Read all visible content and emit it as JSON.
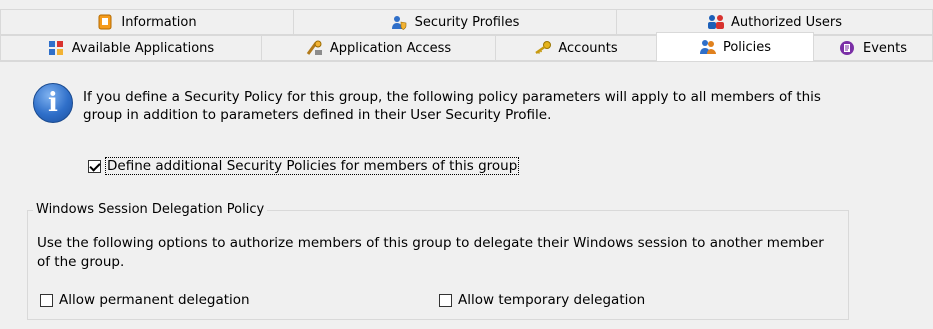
{
  "tabs_row1": [
    {
      "label": "Information",
      "icon": "notebook-icon"
    },
    {
      "label": "Security Profiles",
      "icon": "user-shield-icon"
    },
    {
      "label": "Authorized Users",
      "icon": "users-icon"
    }
  ],
  "tabs_row2": [
    {
      "label": "Available Applications",
      "icon": "apps-grid-icon"
    },
    {
      "label": "Application Access",
      "icon": "app-access-icon"
    },
    {
      "label": "Accounts",
      "icon": "keys-icon"
    },
    {
      "label": "Policies",
      "icon": "policy-users-icon",
      "active": true
    },
    {
      "label": "Events",
      "icon": "events-icon"
    }
  ],
  "info": {
    "text": "If you define a Security Policy for this group, the following policy parameters will apply to all members of this group in addition to parameters defined in their User Security Profile."
  },
  "define_policies": {
    "label": "Define additional Security Policies for members of this group",
    "checked": true
  },
  "delegation": {
    "legend": "Windows Session Delegation Policy",
    "description": "Use the following options to authorize members of this group to delegate their Windows session to another member of the group.",
    "permanent_label": "Allow permanent delegation",
    "permanent_checked": false,
    "temporary_label": "Allow temporary delegation",
    "temporary_checked": false
  },
  "colors": {
    "accent_blue": "#2f6fc9",
    "tab_border": "#d9d9d9",
    "background": "#f0f0f0"
  }
}
